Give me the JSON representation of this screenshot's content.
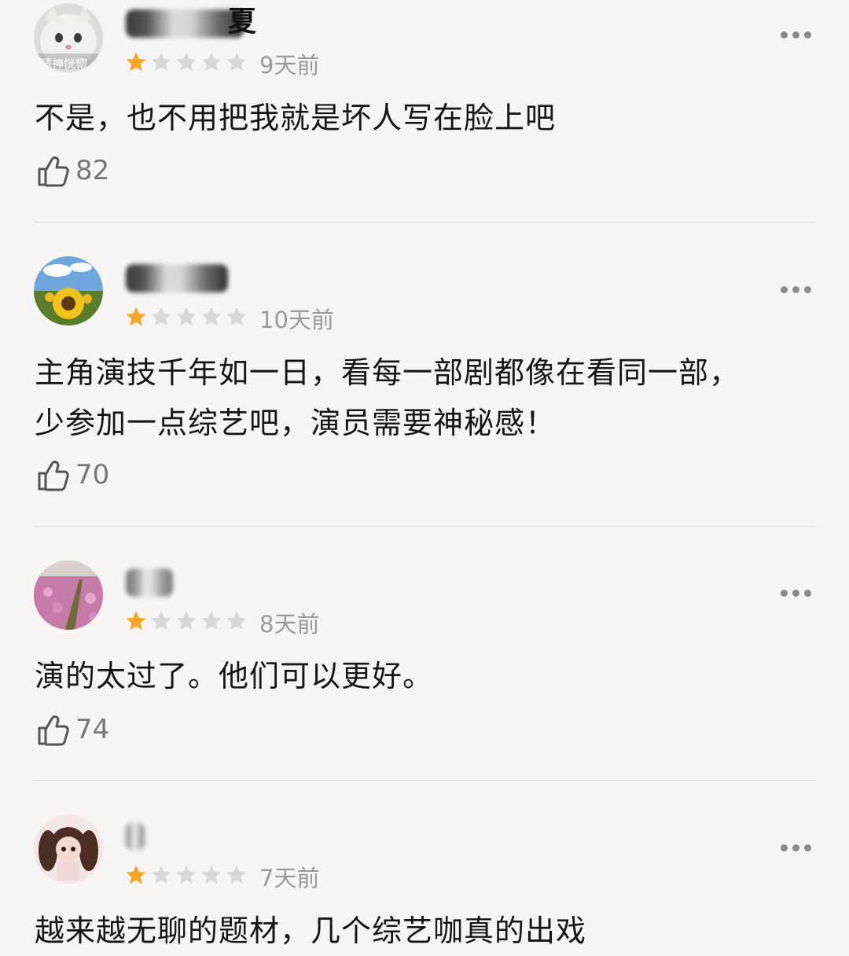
{
  "reviews": [
    {
      "avatar_icon": "cat-avatar",
      "avatar_caption": "精神恍惚",
      "username_visible": "夏",
      "rating": 1,
      "rating_max": 5,
      "time": "9天前",
      "content": "不是，也不用把我就是坏人写在脸上吧",
      "likes": "82"
    },
    {
      "avatar_icon": "sunflower-avatar",
      "username_visible": "",
      "rating": 1,
      "rating_max": 5,
      "time": "10天前",
      "content": "主角演技千年如一日，看每一部剧都像在看同一部，少参加一点综艺吧，演员需要神秘感！",
      "likes": "70"
    },
    {
      "avatar_icon": "flower-field-avatar",
      "username_visible": "",
      "rating": 1,
      "rating_max": 5,
      "time": "8天前",
      "content": "演的太过了。他们可以更好。",
      "likes": "74"
    },
    {
      "avatar_icon": "anime-girl-avatar",
      "username_visible": "",
      "rating": 1,
      "rating_max": 5,
      "time": "7天前",
      "content": "越来越无聊的题材，几个综艺咖真的出戏",
      "likes": ""
    }
  ],
  "colors": {
    "star_filled": "#f5a623",
    "star_empty": "#d9d6d6",
    "background": "#f7f4f4",
    "meta_text": "#9a9a9a"
  },
  "icons": {
    "like": "thumbs-up-icon",
    "more": "more-horizontal-icon",
    "star": "star-icon"
  }
}
